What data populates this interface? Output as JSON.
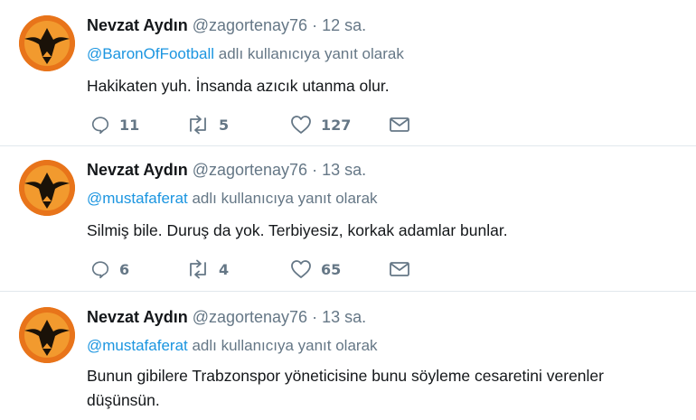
{
  "tweets": [
    {
      "name": "Nevzat Aydın",
      "handle": "@zagortenay76",
      "sep": "·",
      "time": "12 sa.",
      "reply_mention": "@BaronOfFootball",
      "reply_suffix": " adlı kullanıcıya yanıt olarak",
      "text": "Hakikaten yuh. İnsanda azıcık utanma olur.",
      "replies": "11",
      "retweets": "5",
      "likes": "127"
    },
    {
      "name": "Nevzat Aydın",
      "handle": "@zagortenay76",
      "sep": "·",
      "time": "13 sa.",
      "reply_mention": "@mustafaferat",
      "reply_suffix": " adlı kullanıcıya yanıt olarak",
      "text": "Silmiş bile. Duruş da yok. Terbiyesiz, korkak adamlar bunlar.",
      "replies": "6",
      "retweets": "4",
      "likes": "65"
    },
    {
      "name": "Nevzat Aydın",
      "handle": "@zagortenay76",
      "sep": "·",
      "time": "13 sa.",
      "reply_mention": "@mustafaferat",
      "reply_suffix": " adlı kullanıcıya yanıt olarak",
      "text": "Bunun gibilere Trabzonspor yöneticisine bunu söyleme cesaretini verenler düşünsün."
    }
  ],
  "colors": {
    "accent": "#1b95e0",
    "muted": "#657786",
    "text": "#14171a",
    "divider": "#e1e8ed",
    "avatar": "#e8741a"
  }
}
